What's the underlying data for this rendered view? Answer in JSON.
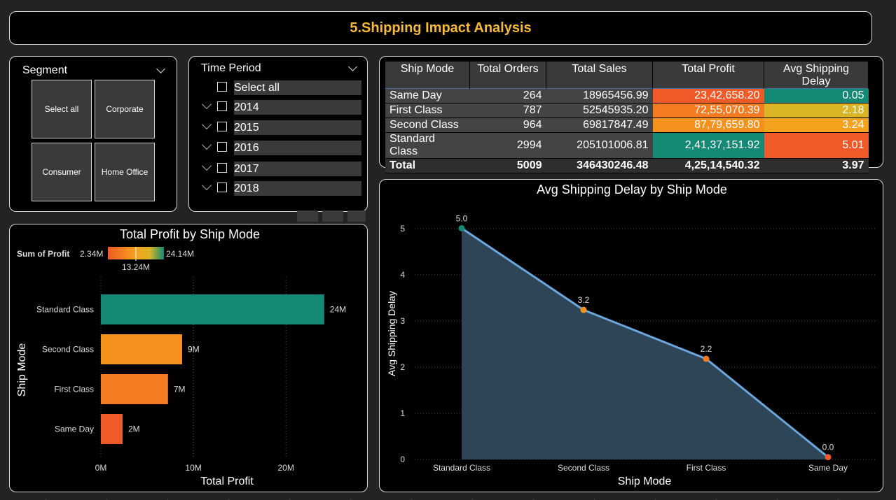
{
  "page_title": "5.Shipping Impact Analysis",
  "segment": {
    "title": "Segment",
    "tiles": [
      "Select all",
      "Corporate",
      "Consumer",
      "Home Office"
    ]
  },
  "time_period": {
    "title": "Time Period",
    "items": [
      "Select all",
      "2014",
      "2015",
      "2016",
      "2017",
      "2018"
    ]
  },
  "table": {
    "headers": [
      "Ship Mode",
      "Total Orders",
      "Total Sales",
      "Total Profit",
      "Avg Shipping Delay"
    ],
    "rows": [
      {
        "mode": "Same Day",
        "orders": "264",
        "sales": "18965456.99",
        "profit": "23,42,658.20",
        "delay": "0.05",
        "profit_color": "#f05a28",
        "delay_color": "#148a74"
      },
      {
        "mode": "First Class",
        "orders": "787",
        "sales": "52545935.20",
        "profit": "72,55,070.39",
        "delay": "2.18",
        "profit_color": "#f57b22",
        "delay_color": "#d9b425"
      },
      {
        "mode": "Second Class",
        "orders": "964",
        "sales": "69817847.49",
        "profit": "87,79,659.80",
        "delay": "3.24",
        "profit_color": "#f5921e",
        "delay_color": "#f5a21e"
      },
      {
        "mode": "Standard Class",
        "orders": "2994",
        "sales": "205101006.81",
        "profit": "2,41,37,151.92",
        "delay": "5.01",
        "profit_color": "#148a74",
        "delay_color": "#f05a28"
      }
    ],
    "total": {
      "mode": "Total",
      "orders": "5009",
      "sales": "346430246.48",
      "profit": "4,25,14,540.32",
      "delay": "3.97"
    }
  },
  "chart_data": [
    {
      "type": "bar",
      "title": "Total Profit by Ship Mode",
      "xlabel": "Total Profit",
      "ylabel": "Ship Mode",
      "categories": [
        "Standard Class",
        "Second Class",
        "First Class",
        "Same Day"
      ],
      "values": [
        24137151.92,
        8779659.8,
        7255070.39,
        2342658.2
      ],
      "data_labels": [
        "24M",
        "9M",
        "7M",
        "2M"
      ],
      "colors": [
        "#148a74",
        "#f5921e",
        "#f57b22",
        "#f05a28"
      ],
      "xlim": [
        0,
        26500000
      ],
      "xticks": [
        0,
        10000000,
        20000000
      ],
      "xtick_labels": [
        "0M",
        "10M",
        "20M"
      ],
      "legend": {
        "title": "Sum of Profit",
        "min_label": "2.34M",
        "mid_label": "13.24M",
        "max_label": "24.14M"
      }
    },
    {
      "type": "area",
      "title": "Avg Shipping Delay by Ship Mode",
      "xlabel": "Ship Mode",
      "ylabel": "Avg Shipping Delay",
      "categories": [
        "Standard Class",
        "Second Class",
        "First Class",
        "Same Day"
      ],
      "values": [
        5.01,
        3.24,
        2.18,
        0.05
      ],
      "data_labels": [
        "5.0",
        "3.2",
        "2.2",
        "0.0"
      ],
      "marker_colors": [
        "#148a74",
        "#f5921e",
        "#f57b22",
        "#f05a28"
      ],
      "ylim": [
        0,
        5
      ],
      "yticks": [
        0,
        1,
        2,
        3,
        4,
        5
      ],
      "line_color": "#6aa7dd",
      "fill_color": "#2e4457",
      "grid": true
    }
  ]
}
